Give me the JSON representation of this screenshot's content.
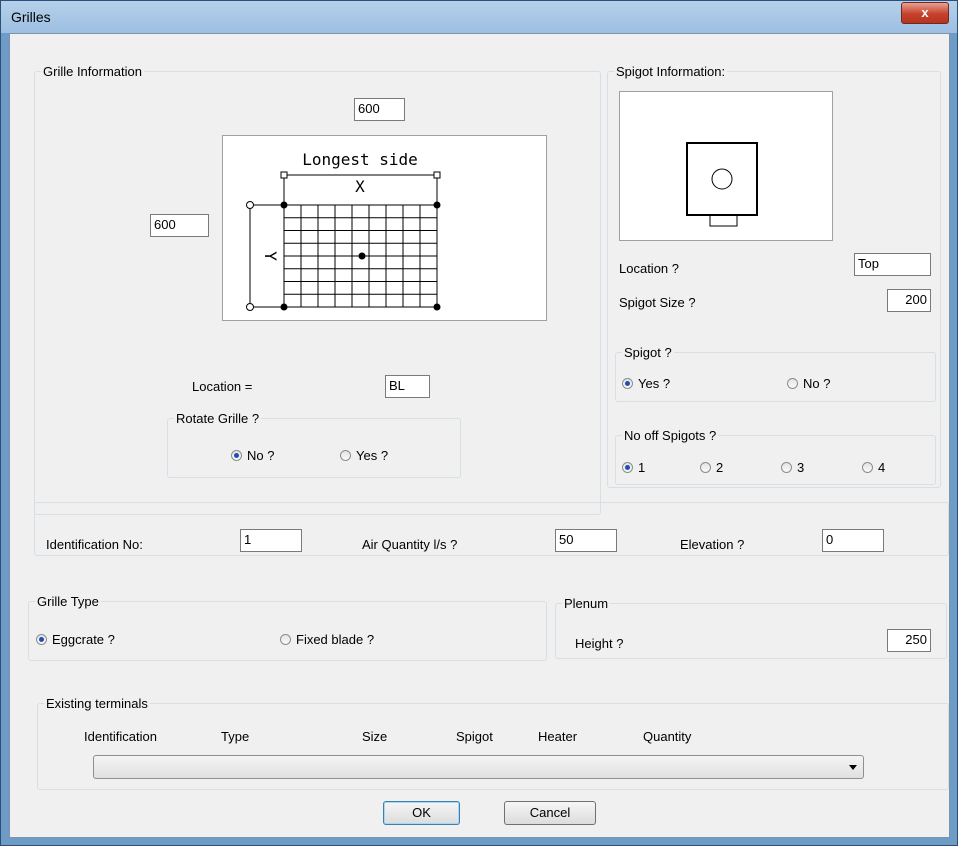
{
  "window": {
    "title": "Grilles",
    "close_glyph": "x"
  },
  "grille_info": {
    "legend": "Grille Information",
    "width_value": "600",
    "height_value": "600",
    "preview": {
      "longest_side": "Longest side",
      "x_label": "X",
      "y_label": "Y"
    },
    "location_label": "Location =",
    "location_value": "BL",
    "rotate": {
      "legend": "Rotate Grille ?",
      "no_label": "No ?",
      "yes_label": "Yes ?",
      "selected": "No ?"
    }
  },
  "spigot_info": {
    "legend": "Spigot Information:",
    "location_label": "Location ?",
    "location_value": "Top",
    "size_label": "Spigot Size ?",
    "size_value": "200",
    "spigot": {
      "legend": "Spigot ?",
      "yes_label": "Yes ?",
      "no_label": "No ?",
      "selected": "Yes ?"
    },
    "count": {
      "legend": "No off Spigots ?",
      "options": [
        "1",
        "2",
        "3",
        "4"
      ],
      "selected": "1"
    }
  },
  "ident_row": {
    "id_label": "Identification No:",
    "id_value": "1",
    "air_label": "Air Quantity l/s ?",
    "air_value": "50",
    "elev_label": "Elevation ?",
    "elev_value": "0"
  },
  "grille_type": {
    "legend": "Grille Type",
    "eggcrate_label": "Eggcrate ?",
    "fixed_label": "Fixed blade ?",
    "selected": "Eggcrate ?"
  },
  "plenum": {
    "legend": "Plenum",
    "height_label": "Height ?",
    "height_value": "250"
  },
  "existing": {
    "legend": "Existing terminals",
    "columns": [
      "Identification",
      "Type",
      "Size",
      "Spigot",
      "Heater",
      "Quantity"
    ],
    "selected_value": ""
  },
  "buttons": {
    "ok": "OK",
    "cancel": "Cancel"
  },
  "colors": {
    "titlebar": "#b6d0ea",
    "dialog_bg": "#f0f0f0",
    "close_red": "#c6412b",
    "radio_dot": "#1f4fb0"
  },
  "icons": {
    "close": "close-icon",
    "dropdown": "chevron-down-icon"
  }
}
